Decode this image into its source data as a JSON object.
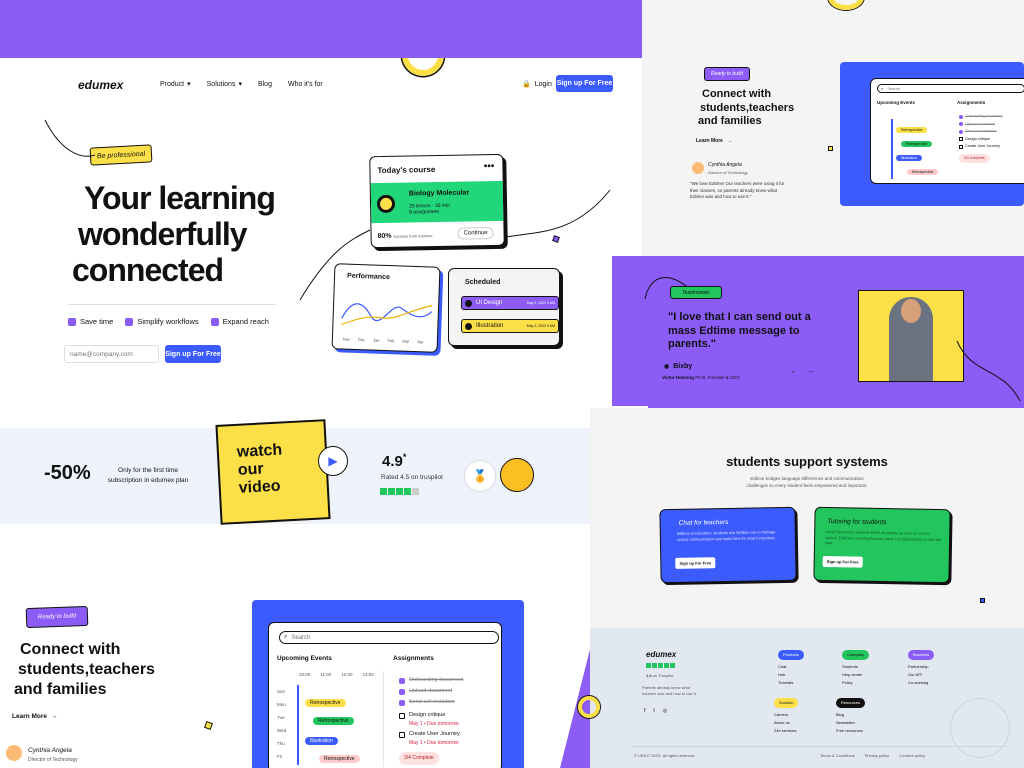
{
  "colors": {
    "purple": "#8b5cf6",
    "blue": "#3b5bfd",
    "yellow": "#fde047",
    "green": "#22c55e"
  },
  "brand": "edumex",
  "nav": {
    "items": [
      "Product",
      "Solutions",
      "Blog",
      "Who it's for"
    ],
    "login": "Login",
    "signup": "Sign up For Free"
  },
  "hero": {
    "badge": "Be professional",
    "title_1": "Your learning",
    "title_2": "wonderfully",
    "title_3": "connected",
    "features": [
      "Save time",
      "Simplify workflows",
      "Expand reach"
    ],
    "email_placeholder": "name@company.com",
    "cta": "Sign up For Free"
  },
  "course_card": {
    "title": "Today's course",
    "course": "Biology Molecular",
    "lessons": "25 lesson",
    "duration": "35 min",
    "assignments": "8 assignment",
    "progress": "80%",
    "progress_text": "success from edumex",
    "continue": "Continue"
  },
  "performance_card": {
    "title": "Performance",
    "months": [
      "Nov",
      "Dec",
      "Jan",
      "Feb",
      "Mar",
      "Apr"
    ]
  },
  "scheduled_card": {
    "title": "Scheduled",
    "items": [
      {
        "label": "UI Design",
        "date": "May 2, 2023 9 AM"
      },
      {
        "label": "Illustration",
        "date": "May 2, 2023 9 AM"
      }
    ]
  },
  "promo": {
    "discount": "-50%",
    "discount_text": "Only for the first time subscription in edumex plan",
    "video_1": "watch",
    "video_2": "our",
    "video_3": "video",
    "rating": "4.9",
    "rating_star": "*",
    "rating_text": "Rated 4.5 on truspilot"
  },
  "connect": {
    "tag": "Ready to build",
    "title_1": "Connect with",
    "title_2": "students,teachers",
    "title_3": "and families",
    "learn_more": "Learn More",
    "quote": "\"We love Edtime! Our teachers were using it for their classes, so parents already knew what Edtime was and how to use it.\"",
    "person_name": "Cynthia Angela",
    "person_role": "Director of Technology"
  },
  "dashboard": {
    "search": "Search",
    "upcoming": "Upcoming Events",
    "assignments": "Assignments",
    "days": [
      "Sun",
      "Mon",
      "Tue",
      "Wed",
      "Thu",
      "Fri"
    ],
    "hours": [
      "10:00",
      "11:00",
      "12:00",
      "13:00"
    ],
    "events": [
      "Retrospective",
      "Retrospective",
      "Illustration",
      "Retrospective"
    ],
    "tasks": [
      {
        "label": "Onboarding document",
        "done": true
      },
      {
        "label": "Upload document",
        "done": true
      },
      {
        "label": "Send cell invitation",
        "done": true
      },
      {
        "label": "Design critique",
        "note": "May 1 • Due tomorrow",
        "done": false
      },
      {
        "label": "Create User Journey",
        "note": "May 1 • Due tomorrow",
        "done": false
      }
    ],
    "complete": "3/4 Complete"
  },
  "testimonial": {
    "tag": "Testimonials",
    "quote": "\"I love that I can send out a mass Edtime message to parents.\"",
    "company": "Bixby",
    "author": "Victor Henning",
    "author_role": "Ph.D, Founder & CEO"
  },
  "support": {
    "title": "students support systems",
    "subtitle": "Edtime bridges language differences and communication challenges so every student feels empowered and important.",
    "chat_title": "Chat  for teachers",
    "chat_text": "Millions of educators, students and families use to manage school communication and make time for what's important.",
    "tutor_title": "Tutoring  for students",
    "tutor_text": "Local Elementary reached 100% of parents as soon as school started. Edtime's rostering features allow Lost Elementary to start the year.",
    "cta": "Sign up For Free"
  },
  "footer": {
    "rating": "4.8",
    "rating_text": "on Truspilot",
    "desc": "Parents already knew what edumex was and how to use it.",
    "cols": [
      {
        "title": "Products",
        "items": [
          "Chat",
          "Hub",
          "Tutorials"
        ]
      },
      {
        "title": "Company",
        "items": [
          "Students",
          "Help center",
          "Policy"
        ]
      },
      {
        "title": "Business",
        "items": [
          "Partnership",
          "Our API",
          "Co-working"
        ]
      },
      {
        "title": "Solution",
        "items": [
          "Careers",
          "About us",
          "24h services"
        ]
      },
      {
        "title": "Resources",
        "items": [
          "Blog",
          "Newsletter",
          "Free resources"
        ]
      }
    ],
    "copyright": "© UIHUT 2022, all rights reserved.",
    "links": [
      "Terms & Conditions",
      "Privacy policy",
      "Cookies policy"
    ]
  }
}
